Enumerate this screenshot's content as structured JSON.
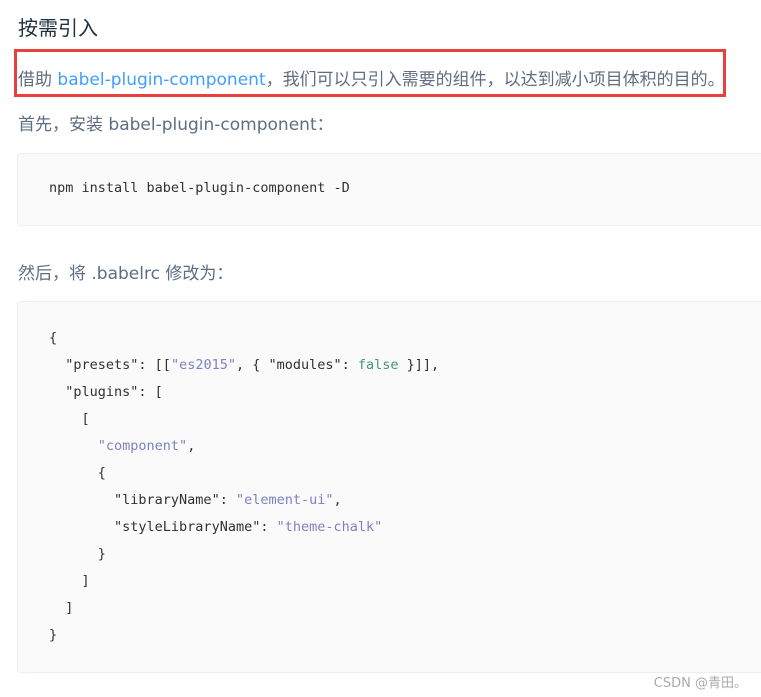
{
  "section": {
    "heading": "按需引入",
    "intro_prefix": "借助 ",
    "intro_link": "babel-plugin-component",
    "intro_suffix": "，我们可以只引入需要的组件，以达到减小项目体积的目的。",
    "step1_text": "首先，安装 babel-plugin-component：",
    "install_command": "npm install babel-plugin-component -D",
    "step2_text": "然后，将 .babelrc 修改为："
  },
  "babelrc": {
    "open_brace": "{",
    "presets_key": "\"presets\"",
    "presets_open": ": [[",
    "preset_name": "\"es2015\"",
    "presets_mid": ", { ",
    "modules_key": "\"modules\"",
    "colon": ": ",
    "modules_value": "false",
    "presets_close": " }]],",
    "plugins_key": "\"plugins\"",
    "plugins_open": ": [",
    "inner_array_open": "[",
    "component_name": "\"component\"",
    "comma": ",",
    "obj_open": "{",
    "library_key": "\"libraryName\"",
    "library_value": "\"element-ui\"",
    "style_key": "\"styleLibraryName\"",
    "style_value": "\"theme-chalk\"",
    "obj_close": "}",
    "inner_array_close": "]",
    "plugins_close": "]",
    "close_brace": "}"
  },
  "watermark": "CSDN @青田。",
  "colors": {
    "highlight_border": "#e84040",
    "link": "#409eff",
    "string": "#8080c0",
    "keyword": "#3f9c6e"
  }
}
